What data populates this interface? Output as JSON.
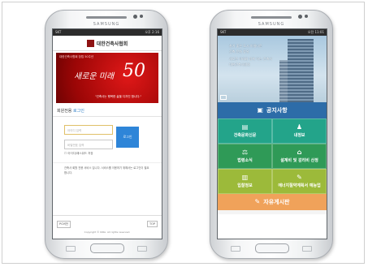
{
  "left_phone": {
    "brand": "SAMSUNG",
    "status": {
      "left": "SKT",
      "right": "오후 2:16"
    },
    "header_title": "대한건축사협회",
    "banner": {
      "top_text": "대한건축사협회 창립 50주년",
      "script_text": "새로운 미래",
      "anniversary": "50",
      "slogan": "\"건축사는 행복한 삶을 디자인 합니다.\""
    },
    "login_heading": {
      "prefix": "회원전용 ",
      "accent": "로그인"
    },
    "id_placeholder": "아이디 입력",
    "pw_placeholder": "비밀번호 입력",
    "login_button": "로그인",
    "remember_label": "아이디/패스워드 저장",
    "note": "건축사 회원 전용 서비스 입니다. 서비스를 이용하기 위해서는 로그인이 필요합니다.",
    "pc_view": "PC버전",
    "top_button": "TOP",
    "copyright": "Copyright © KIRA. All rights reserved."
  },
  "right_phone": {
    "brand": "SAMSUNG",
    "status": {
      "left": "SKT",
      "right": "오전 11:01"
    },
    "hero_lines": [
      "살기 좋은 도시 아름다운",
      "건축 문화 창달",
      "새로운 미래와 함께 하는 건축사",
      "대한건축사협회"
    ],
    "notice": "공지사항",
    "menu": [
      {
        "label": "건축문화신문",
        "icon": "▤",
        "color": "#23a48a"
      },
      {
        "label": "내정보",
        "icon": "♟",
        "color": "#23a48a"
      },
      {
        "label": "법령소식",
        "icon": "⚖",
        "color": "#2f9a57"
      },
      {
        "label": "설계비 및 감리비 산정",
        "icon": "⌂",
        "color": "#2f9a57"
      },
      {
        "label": "입찰정보",
        "icon": "▥",
        "color": "#9cba3a"
      },
      {
        "label": "에너지절약계획서 예능업",
        "icon": "✎",
        "color": "#9cba3a"
      }
    ],
    "free_board": "자유게시판"
  }
}
